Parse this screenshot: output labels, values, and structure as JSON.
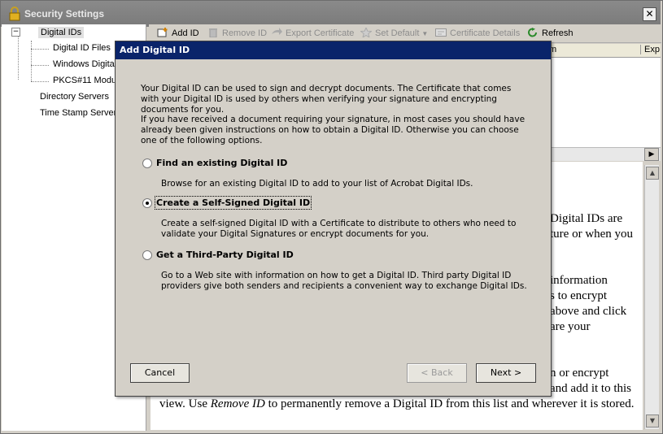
{
  "window": {
    "title": "Security Settings",
    "close_label": "✕"
  },
  "tree": {
    "toggle": "−",
    "items": [
      "Digital IDs",
      "Digital ID Files",
      "Windows Digital",
      "PKCS#11 Modul",
      "Directory Servers",
      "Time Stamp Servers"
    ]
  },
  "toolbar": {
    "add_id": "Add ID",
    "remove_id": "Remove ID",
    "export_certificate": "Export Certificate",
    "set_default": "Set Default",
    "certificate_details": "Certificate Details",
    "refresh": "Refresh"
  },
  "list": {
    "col_name": "m",
    "col_expires": "Exp"
  },
  "description": {
    "lines": [
      "Digital IDs are",
      "ture or when you",
      "information",
      "s to encrypt",
      "above and click",
      "are your",
      "n or encrypt",
      "and add it to this"
    ],
    "last_line_pre": "view. Use ",
    "last_line_em": "Remove ID",
    "last_line_post": " to permanently remove a Digital ID from this list and wherever it is stored."
  },
  "dialog": {
    "title": "Add Digital ID",
    "intro": "Your Digital ID can be used to sign and decrypt documents. The Certificate that comes with your Digital ID is used by others when verifying your signature and encrypting documents for you.",
    "intro2": "If you have received a document requiring your signature, in most cases you should have already been given instructions on how to obtain a Digital ID. Otherwise you can choose one of the following options.",
    "options": [
      {
        "label": "Find an existing Digital ID",
        "desc": "Browse for an existing Digital ID to add to your list of Acrobat Digital IDs.",
        "selected": false
      },
      {
        "label": "Create a Self-Signed Digital ID",
        "desc": "Create a self-signed Digital ID with a Certificate to distribute to others who need to validate your Digital Signatures or encrypt documents for you.",
        "selected": true
      },
      {
        "label": "Get a Third-Party Digital ID",
        "desc": "Go to a Web site with information on how to get a Digital ID. Third party Digital ID providers give both senders and recipients a convenient way to exchange Digital IDs.",
        "selected": false
      }
    ],
    "cancel": "Cancel",
    "back": "< Back",
    "next": "Next >"
  },
  "icons": [
    "lock-icon",
    "add-id-icon",
    "remove-id-icon",
    "export-icon",
    "star-icon",
    "certificate-icon",
    "refresh-icon"
  ]
}
